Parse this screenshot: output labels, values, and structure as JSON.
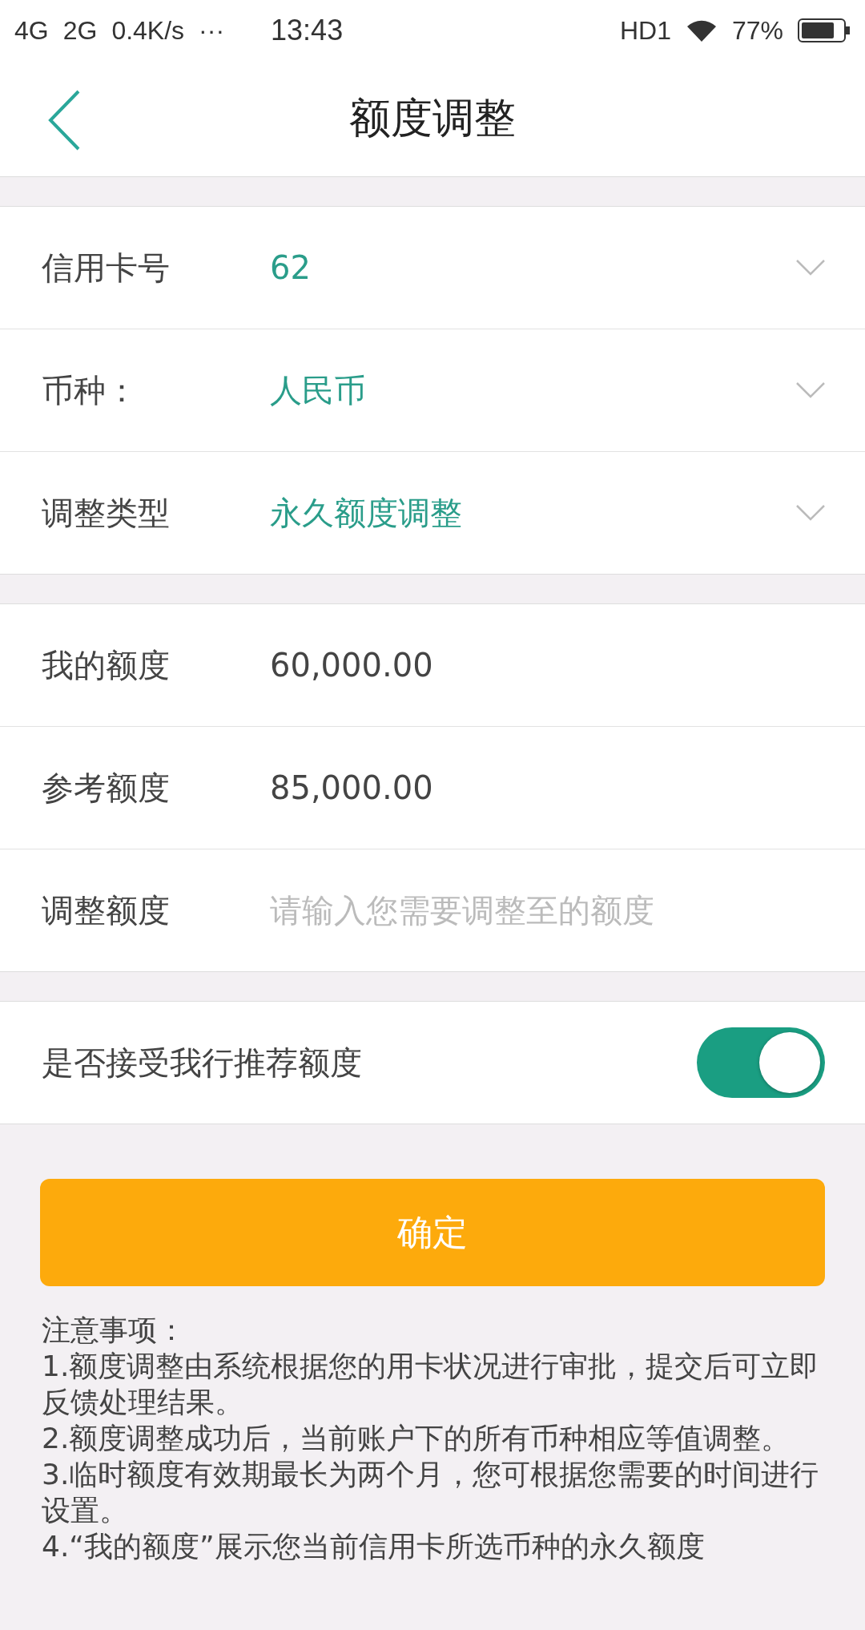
{
  "status_bar": {
    "left": [
      "4G",
      "2G",
      "0.4K/s",
      "···"
    ],
    "time": "13:43",
    "hd": "HD1",
    "battery": "77%"
  },
  "header": {
    "title": "额度调整"
  },
  "sections": [
    {
      "rows": [
        {
          "kind": "select",
          "label": "信用卡号",
          "value": "62"
        },
        {
          "kind": "select",
          "label": "币种：",
          "value": "人民币"
        },
        {
          "kind": "select",
          "label": "调整类型",
          "value": "永久额度调整"
        }
      ]
    },
    {
      "rows": [
        {
          "kind": "text",
          "label": "我的额度",
          "value": "60,000.00"
        },
        {
          "kind": "text",
          "label": "参考额度",
          "value": "85,000.00"
        },
        {
          "kind": "input",
          "label": "调整额度",
          "placeholder": "请输入您需要调整至的额度"
        }
      ]
    },
    {
      "rows": [
        {
          "kind": "toggle",
          "label": "是否接受我行推荐额度",
          "on": true
        }
      ]
    }
  ],
  "confirm_button": "确定",
  "notes": {
    "title": "注意事项：",
    "items": [
      "1.额度调整由系统根据您的用卡状况进行审批，提交后可立即反馈处理结果。",
      "2.额度调整成功后，当前账户下的所有币种相应等值调整。",
      "3.临时额度有效期最长为两个月，您可根据您需要的时间进行设置。",
      "4.“我的额度”展示您当前信用卡所选币种的永久额度"
    ]
  }
}
